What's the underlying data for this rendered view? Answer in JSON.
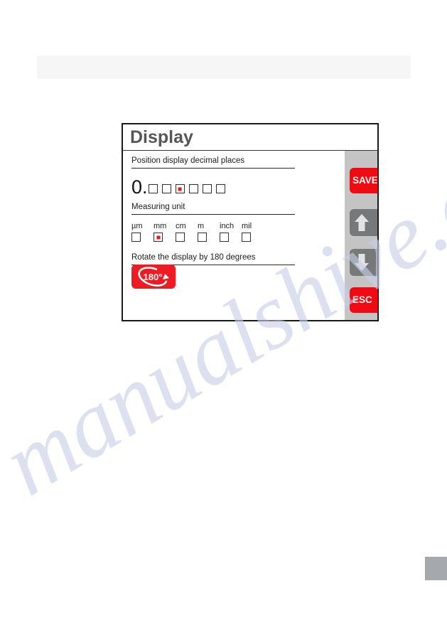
{
  "document": {
    "watermark_text": "manualshive.com"
  },
  "header_band": {
    "label": ""
  },
  "device_screen": {
    "title": "Display",
    "sections": [
      {
        "label": "Position display decimal places",
        "name": "position-display-decimal-places"
      },
      {
        "label": "Measuring unit",
        "name": "measuring-unit"
      },
      {
        "label": "Rotate the display by 180 degrees",
        "name": "rotate-display"
      }
    ],
    "decimal_places": {
      "prefix": "0.",
      "boxes": [
        {
          "index": 1,
          "checked": false
        },
        {
          "index": 2,
          "checked": false
        },
        {
          "index": 3,
          "checked": true
        },
        {
          "index": 4,
          "checked": false
        },
        {
          "index": 5,
          "checked": false
        },
        {
          "index": 6,
          "checked": false
        }
      ],
      "selected_index": 3
    },
    "measuring_units": {
      "options": [
        {
          "label": "µm",
          "checked": false
        },
        {
          "label": "mm",
          "checked": true
        },
        {
          "label": "cm",
          "checked": false
        },
        {
          "label": "m",
          "checked": false
        },
        {
          "label": "inch",
          "checked": false
        },
        {
          "label": "mil",
          "checked": false
        }
      ],
      "selected": "mm"
    },
    "rotate_button": {
      "label": "180°",
      "icon": "rotate-180-icon"
    },
    "sidebar": {
      "buttons": [
        {
          "label": "SAVE",
          "name": "save-button",
          "color": "#f00a14"
        },
        {
          "label": "",
          "name": "scroll-up-button",
          "icon": "arrow-up-icon",
          "color": "#77787a"
        },
        {
          "label": "",
          "name": "scroll-down-button",
          "icon": "arrow-down-icon",
          "color": "#77787a"
        },
        {
          "label": "ESC",
          "name": "escape-button",
          "color": "#f00a14"
        }
      ]
    }
  },
  "colors": {
    "accent_red": "#ed1b24",
    "button_red": "#f00a14",
    "sidebar_gray": "#c4c4c4",
    "arrow_gray": "#77787a",
    "title_gray": "#565656",
    "frame_black": "#1a1a1a",
    "checkbox_mark": "#e8161c",
    "header_band": "#f6f6f7",
    "corner_tab": "#a5a9ad"
  }
}
